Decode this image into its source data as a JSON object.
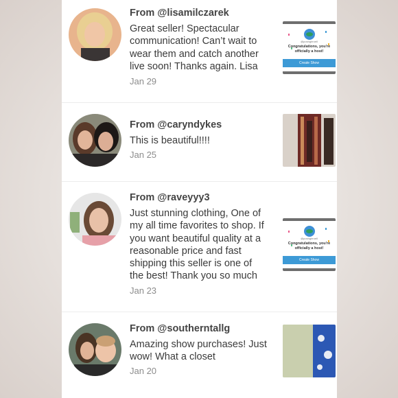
{
  "reviews": [
    {
      "from": "From @lisamilczarek",
      "text": "Great seller! Spectacular communication! Can’t wait to wear them and catch another live soon! Thanks again. Lisa",
      "date": "Jan 29",
      "avatar": "user-avatar",
      "thumbnail": "host-card"
    },
    {
      "from": "From @caryndykes",
      "text": "This is beautiful!!!!",
      "date": "Jan 25",
      "avatar": "user-avatar",
      "thumbnail": "product-photo"
    },
    {
      "from": "From @raveyyy3",
      "text": "Just stunning clothing, One of my all time favorites to shop. If you want beautiful quality at a reasonable price and fast shipping this seller is one of the best! Thank you so much",
      "date": "Jan 23",
      "avatar": "user-avatar",
      "thumbnail": "host-card"
    },
    {
      "from": "From @southerntallg",
      "text": "Amazing show purchases! Just wow! What a closet",
      "date": "Jan 20",
      "avatar": "user-avatar",
      "thumbnail": "product-photo"
    }
  ],
  "host_card": {
    "handle": "@poshgirroell",
    "message": "Congratulations, you're officially a host!",
    "button": "Create Show",
    "button_color": "#3d9ad6"
  }
}
